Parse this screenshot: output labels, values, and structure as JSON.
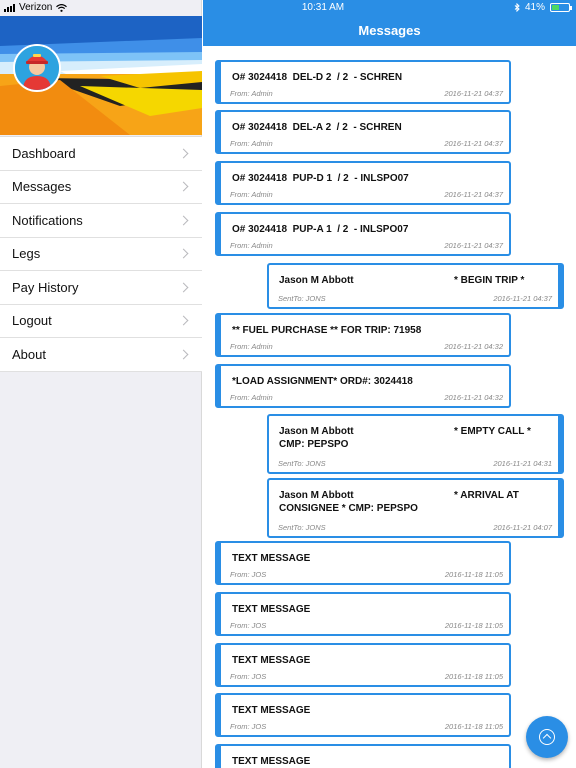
{
  "status_bar": {
    "carrier": "Verizon",
    "time": "10:31 AM",
    "battery": "41%",
    "battery_level": 0.41
  },
  "header": {
    "title": "Messages"
  },
  "sidebar": {
    "items": [
      {
        "label": "Dashboard"
      },
      {
        "label": "Messages"
      },
      {
        "label": "Notifications"
      },
      {
        "label": "Legs"
      },
      {
        "label": "Pay History"
      },
      {
        "label": "Logout"
      },
      {
        "label": "About"
      }
    ]
  },
  "messages": [
    {
      "type": "recv",
      "title": "O# 3024418  DEL-D 2  / 2  - SCHREN",
      "from": "From: Admin",
      "date": "2016-11-21 04:37"
    },
    {
      "type": "recv",
      "title": "O# 3024418  DEL-A 2  / 2  - SCHREN",
      "from": "From: Admin",
      "date": "2016-11-21 04:37"
    },
    {
      "type": "recv",
      "title": "O# 3024418  PUP-D 1  / 2  - INLSPO07",
      "from": "From: Admin",
      "date": "2016-11-21 04:37"
    },
    {
      "type": "recv",
      "title": "O# 3024418  PUP-A 1  / 2  - INLSPO07",
      "from": "From: Admin",
      "date": "2016-11-21 04:37"
    },
    {
      "type": "sent",
      "name": "Jason M Abbott",
      "title": "* BEGIN TRIP *",
      "title2": "",
      "from": "SentTo: JONS",
      "date": "2016-11-21 04:37"
    },
    {
      "type": "recv",
      "title": "** FUEL PURCHASE ** FOR TRIP: 71958",
      "from": "From: Admin",
      "date": "2016-11-21 04:32"
    },
    {
      "type": "recv",
      "title": "*LOAD ASSIGNMENT* ORD#: 3024418",
      "from": "From: Admin",
      "date": "2016-11-21 04:32"
    },
    {
      "type": "sent",
      "name": "Jason M Abbott",
      "title": "* EMPTY CALL *",
      "title2": "CMP: PEPSPO",
      "from": "SentTo: JONS",
      "date": "2016-11-21 04:31"
    },
    {
      "type": "sent",
      "name": "Jason M Abbott",
      "title": "* ARRIVAL AT",
      "title2": "CONSIGNEE * CMP: PEPSPO",
      "from": "SentTo: JONS",
      "date": "2016-11-21 04:07"
    },
    {
      "type": "recv",
      "title": "TEXT MESSAGE",
      "from": "From: JOS",
      "date": "2016-11-18 11:05"
    },
    {
      "type": "recv",
      "title": "TEXT MESSAGE",
      "from": "From: JOS",
      "date": "2016-11-18 11:05"
    },
    {
      "type": "recv",
      "title": "TEXT MESSAGE",
      "from": "From: JOS",
      "date": "2016-11-18 11:05"
    },
    {
      "type": "recv",
      "title": "TEXT MESSAGE",
      "from": "From: JOS",
      "date": "2016-11-18 11:05"
    },
    {
      "type": "recv",
      "title": "TEXT MESSAGE",
      "from": "",
      "date": ""
    }
  ],
  "colors": {
    "accent": "#2a8ee5",
    "sidebar_bg": "#efeff4"
  },
  "icons": {
    "fab": "scroll-up-icon",
    "chevron": "chevron-right-icon"
  }
}
